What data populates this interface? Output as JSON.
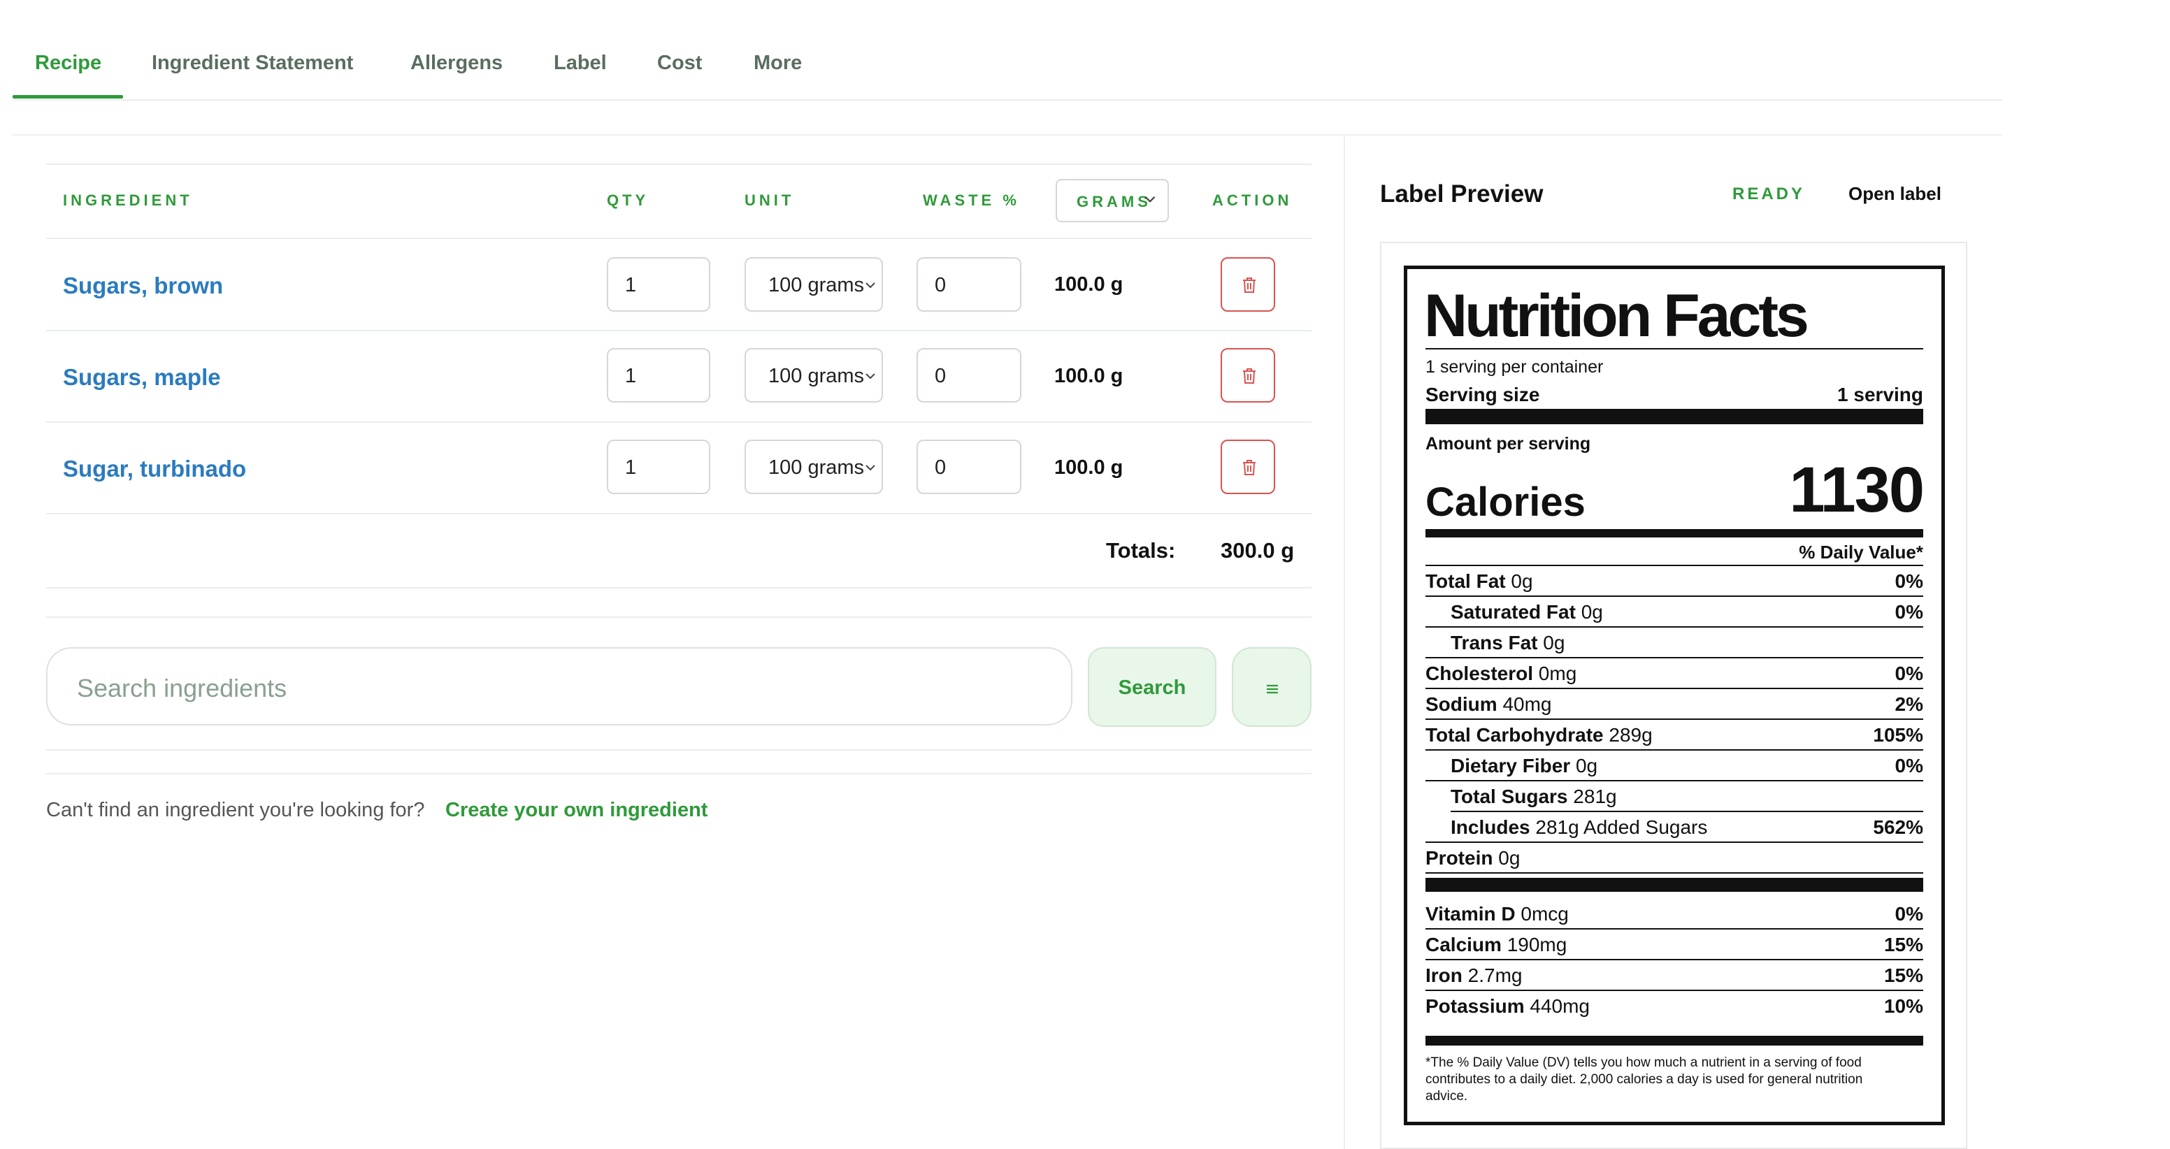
{
  "tabs": [
    {
      "label": "Recipe",
      "active": true
    },
    {
      "label": "Ingredient Statement"
    },
    {
      "label": "Allergens"
    },
    {
      "label": "Label"
    },
    {
      "label": "Cost"
    },
    {
      "label": "More"
    }
  ],
  "table": {
    "headers": {
      "ingredient": "INGREDIENT",
      "qty": "QTY",
      "unit": "UNIT",
      "waste": "WASTE %",
      "grams": "GRAMS",
      "action": "ACTION"
    },
    "rows": [
      {
        "name": "Sugars, brown",
        "qty": "1",
        "unit": "100 grams",
        "waste": "0",
        "grams": "100.0 g"
      },
      {
        "name": "Sugars, maple",
        "qty": "1",
        "unit": "100 grams",
        "waste": "0",
        "grams": "100.0 g"
      },
      {
        "name": "Sugar, turbinado",
        "qty": "1",
        "unit": "100 grams",
        "waste": "0",
        "grams": "100.0 g"
      }
    ],
    "totals_label": "Totals:",
    "totals_value": "300.0 g"
  },
  "search": {
    "placeholder": "Search ingredients",
    "button_label": "Search",
    "menu_icon": "≡"
  },
  "footer": {
    "note": "Can't find an ingredient you're looking for?",
    "link": "Create your own ingredient"
  },
  "label_preview": {
    "title": "Label Preview",
    "status": "READY",
    "open_label": "Open label"
  },
  "nutrition": {
    "title": "Nutrition Facts",
    "servings_per_container": "1 serving per container",
    "serving_size_label": "Serving size",
    "serving_size_value": "1 serving",
    "amount_per_serving": "Amount per serving",
    "calories_label": "Calories",
    "calories_value": "1130",
    "dv_header": "% Daily Value*",
    "nutrients": [
      {
        "name": "Total Fat",
        "amount": " 0g",
        "dv": "0%"
      },
      {
        "name": "Saturated Fat",
        "amount": " 0g",
        "dv": "0%"
      },
      {
        "name": "Trans Fat",
        "amount": " 0g",
        "dv": ""
      },
      {
        "name": "Cholesterol",
        "amount": " 0mg",
        "dv": "0%"
      },
      {
        "name": "Sodium",
        "amount": " 40mg",
        "dv": "2%"
      },
      {
        "name": "Total Carbohydrate",
        "amount": " 289g",
        "dv": "105%"
      },
      {
        "name": "Dietary Fiber",
        "amount": " 0g",
        "dv": "0%"
      },
      {
        "name": "Total Sugars",
        "amount": " 281g",
        "dv": ""
      },
      {
        "name": "Includes",
        "amount": " 281g Added Sugars",
        "dv": "562%"
      },
      {
        "name": "Protein",
        "amount": " 0g",
        "dv": ""
      }
    ],
    "vitamins": [
      {
        "name": "Vitamin D",
        "amount": " 0mcg",
        "dv": "0%"
      },
      {
        "name": "Calcium",
        "amount": " 190mg",
        "dv": "15%"
      },
      {
        "name": "Iron",
        "amount": " 2.7mg",
        "dv": "15%"
      },
      {
        "name": "Potassium",
        "amount": " 440mg",
        "dv": "10%"
      }
    ],
    "footnote_1": "*The % Daily Value (DV) tells you how much a nutrient in a serving of food",
    "footnote_2": "contributes to a daily diet. 2,000 calories a day is used for general nutrition",
    "footnote_3": "advice."
  },
  "colors": {
    "accent": "#2f9a3a",
    "link": "#2b7bbf",
    "danger": "#d9534f"
  }
}
